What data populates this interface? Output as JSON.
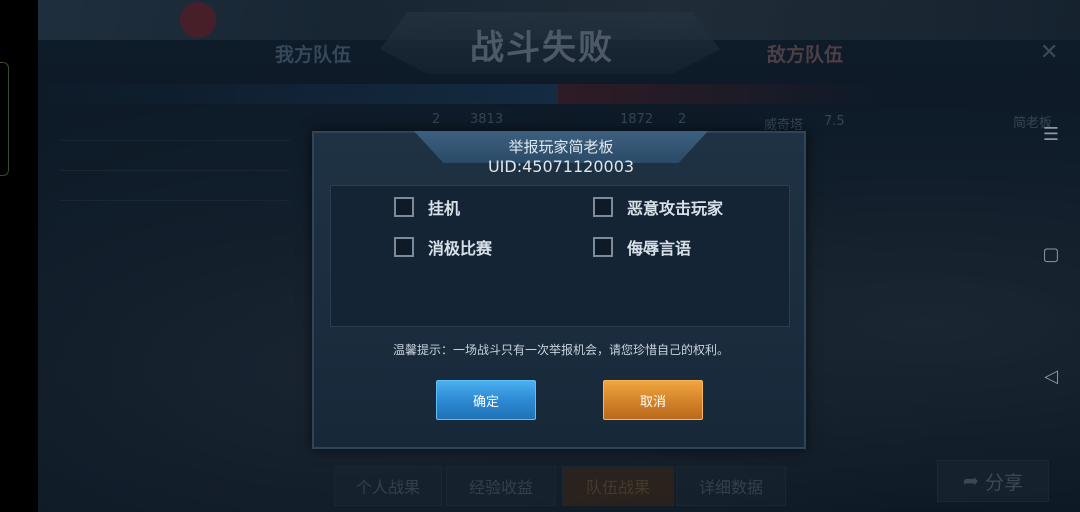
{
  "background": {
    "my_team": "我方队伍",
    "enemy_team": "敌方队伍",
    "result_title": "战斗失败",
    "stats": {
      "my_kills": "2",
      "my_score": "3813",
      "enemy_score": "1872",
      "enemy_kills": "2",
      "enemy_player": "威奇塔",
      "enemy_rating": "7.5",
      "enemy_name": "简老板"
    },
    "tabs": [
      "个人战果",
      "经验收益",
      "队伍战果",
      "详细数据"
    ],
    "share_label": "分享",
    "close_glyph": "✕"
  },
  "dialog": {
    "title": "举报玩家简老板",
    "uid": "UID:45071120003",
    "options": [
      {
        "label": "挂机",
        "checked": false
      },
      {
        "label": "恶意攻击玩家",
        "checked": false
      },
      {
        "label": "消极比赛",
        "checked": false
      },
      {
        "label": "侮辱言语",
        "checked": false
      }
    ],
    "tip": "温馨提示：一场战斗只有一次举报机会，请您珍惜自己的权利。",
    "confirm_label": "确定",
    "cancel_label": "取消"
  },
  "nav": {
    "menu_icon": "☰",
    "home_icon": "▢",
    "back_icon": "◁"
  },
  "colors": {
    "confirm": "#2d8ad3",
    "cancel": "#d5852a",
    "dialog_bg": "#1a2c3e"
  }
}
